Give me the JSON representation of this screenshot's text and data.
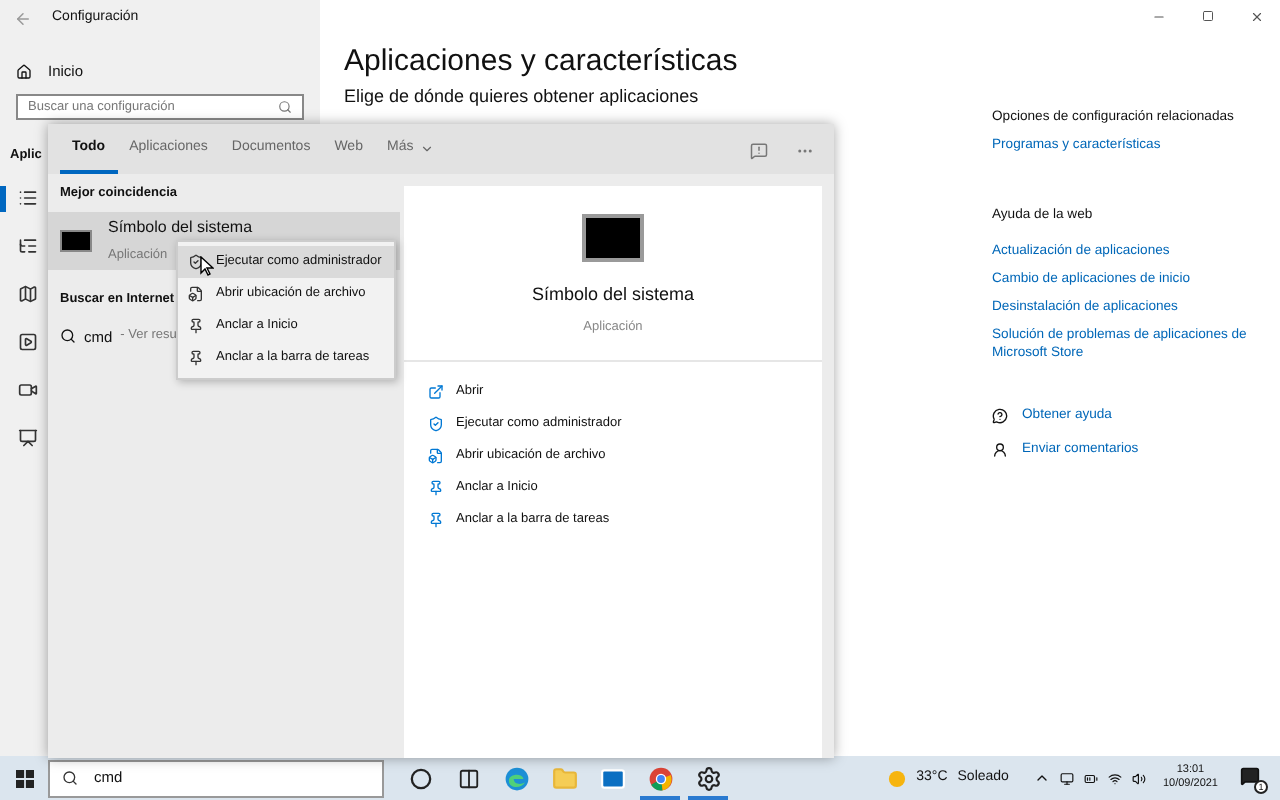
{
  "settings": {
    "title": "Configuración",
    "home": "Inicio",
    "search_placeholder": "Buscar una configuración",
    "section": "Aplic",
    "nav": [
      {
        "kind": "list",
        "selected": true
      },
      {
        "kind": "defaults",
        "selected": false
      },
      {
        "kind": "maps",
        "selected": false
      },
      {
        "kind": "websites",
        "selected": false
      },
      {
        "kind": "video",
        "selected": false
      },
      {
        "kind": "startup",
        "selected": false
      }
    ],
    "heading": "Aplicaciones y características",
    "subheading": "Elige de dónde quieres obtener aplicaciones",
    "related_title": "Opciones de configuración relacionadas",
    "related_links": [
      "Programas y características"
    ],
    "help_title": "Ayuda de la web",
    "help_links": [
      "Actualización de aplicaciones",
      "Cambio de aplicaciones de inicio",
      "Desinstalación de aplicaciones",
      "Solución de problemas de aplicaciones de Microsoft Store"
    ],
    "support": [
      {
        "kind": "help",
        "label": "Obtener ayuda"
      },
      {
        "kind": "feedback",
        "label": "Enviar comentarios"
      }
    ]
  },
  "search": {
    "tabs": [
      {
        "label": "Todo",
        "selected": true,
        "dropdown": false
      },
      {
        "label": "Aplicaciones",
        "selected": false,
        "dropdown": false
      },
      {
        "label": "Documentos",
        "selected": false,
        "dropdown": false
      },
      {
        "label": "Web",
        "selected": false,
        "dropdown": false
      },
      {
        "label": "Más",
        "selected": false,
        "dropdown": true
      }
    ],
    "best_match_label": "Mejor coincidencia",
    "best_match": {
      "name": "Símbolo del sistema",
      "type": "Aplicación",
      "selected": true
    },
    "web_label": "Buscar en Internet",
    "web_query": "cmd",
    "web_hint": "- Ver resu",
    "preview": {
      "name": "Símbolo del sistema",
      "type": "Aplicación"
    },
    "actions": [
      {
        "kind": "open",
        "label": "Abrir"
      },
      {
        "kind": "admin",
        "label": "Ejecutar como administrador"
      },
      {
        "kind": "folder",
        "label": "Abrir ubicación de archivo"
      },
      {
        "kind": "pin",
        "label": "Anclar a Inicio"
      },
      {
        "kind": "pin",
        "label": "Anclar a la barra de tareas"
      }
    ]
  },
  "context_menu": {
    "items": [
      {
        "kind": "admin",
        "label": "Ejecutar como administrador",
        "selected": true
      },
      {
        "kind": "folder",
        "label": "Abrir ubicación de archivo",
        "selected": false
      },
      {
        "kind": "pin",
        "label": "Anclar a Inicio",
        "selected": false
      },
      {
        "kind": "pin",
        "label": "Anclar a la barra de tareas",
        "selected": false
      }
    ]
  },
  "taskbar": {
    "search_value": "cmd",
    "apps": [
      {
        "kind": "cortana",
        "running": false
      },
      {
        "kind": "taskview",
        "running": false
      },
      {
        "kind": "edge",
        "running": false
      },
      {
        "kind": "explorer",
        "running": false
      },
      {
        "kind": "mail",
        "running": false
      },
      {
        "kind": "chrome",
        "running": true
      },
      {
        "kind": "settings",
        "running": true
      }
    ],
    "weather": {
      "temp": "33°C",
      "condition": "Soleado"
    },
    "time": "13:01",
    "date": "10/09/2021",
    "notifications": "1"
  }
}
